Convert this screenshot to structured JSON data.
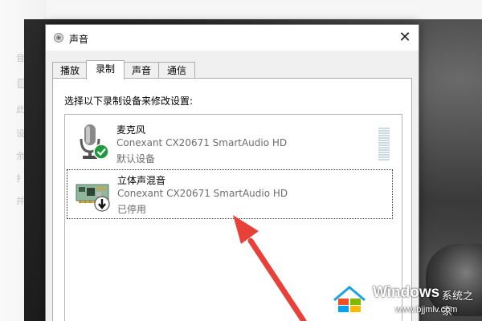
{
  "background": {
    "left_items": [
      "音",
      "此",
      "设",
      "余",
      "扌",
      "并"
    ]
  },
  "dialog": {
    "title": "声音",
    "close_glyph": "✕",
    "tabs": [
      {
        "label": "播放",
        "active": false
      },
      {
        "label": "录制",
        "active": true
      },
      {
        "label": "声音",
        "active": false
      },
      {
        "label": "通信",
        "active": false
      }
    ],
    "instruction": "选择以下录制设备来修改设置:",
    "devices": [
      {
        "name": "麦克风",
        "driver": "Conexant CX20671 SmartAudio HD",
        "status": "默认设备",
        "status_icon": "check-icon",
        "device_icon": "microphone-icon",
        "selected": false
      },
      {
        "name": "立体声混音",
        "driver": "Conexant CX20671 SmartAudio HD",
        "status": "已停用",
        "status_icon": "down-arrow-icon",
        "device_icon": "sound-card-icon",
        "selected": true
      }
    ]
  },
  "watermark": {
    "brand": "Windows",
    "cn": "系统之家",
    "url": "www.bjjmlv.com"
  },
  "colors": {
    "accent_green": "#1e9a3d",
    "annotation_red": "#e8413a",
    "win_blue": "#1aa1e6"
  }
}
